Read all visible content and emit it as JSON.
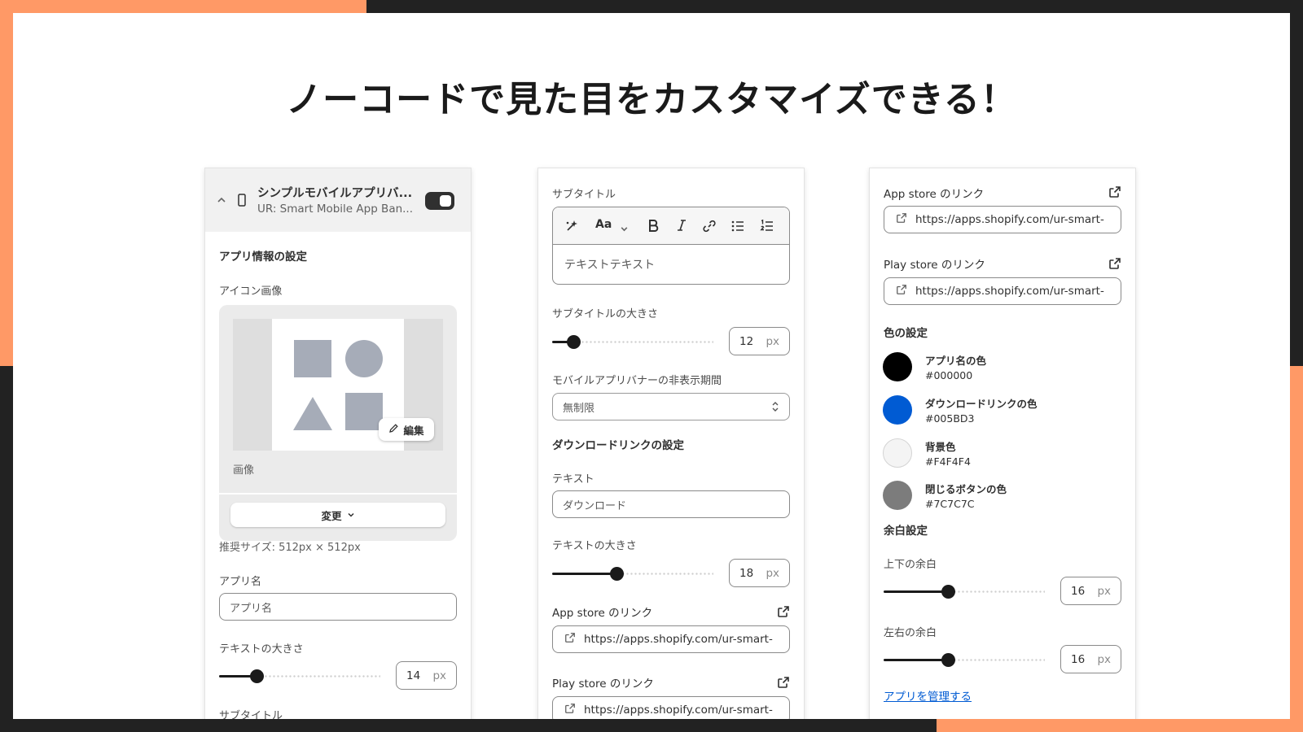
{
  "headline": "ノーコードで見た目をカスタマイズできる！",
  "colors": {
    "accent_orange": "#FF9966",
    "frame_dark": "#222222",
    "link_blue": "#005BD3"
  },
  "panel1": {
    "app_title": "シンプルモバイルアプリバ...",
    "app_subtitle": "UR: Smart Mobile App Ban...",
    "section_app_info": "アプリ情報の設定",
    "icon_image_label": "アイコン画像",
    "edit_label": "編集",
    "image_caption": "画像",
    "change_button": "変更",
    "recommended_size": "推奨サイズ: 512px × 512px",
    "app_name_label": "アプリ名",
    "app_name_value": "アプリ名",
    "text_size_label": "テキストの大きさ",
    "text_size_value": "14",
    "text_size_fraction": 0.23,
    "unit": "px",
    "subtitle_label": "サブタイトル"
  },
  "panel2": {
    "subtitle_label": "サブタイトル",
    "toolbar_font": "Aa",
    "editor_text": "テキストテキスト",
    "subtitle_size_label": "サブタイトルの大きさ",
    "subtitle_size_value": "12",
    "subtitle_size_fraction": 0.13,
    "unit": "px",
    "hide_period_label": "モバイルアプリバナーの非表示期間",
    "hide_period_value": "無制限",
    "download_section": "ダウンロードリンクの設定",
    "text_label": "テキスト",
    "text_value": "ダウンロード",
    "text_size_label": "テキストの大きさ",
    "text_size_value": "18",
    "text_size_fraction": 0.4,
    "app_store_label": "App store のリンク",
    "app_store_url": "https://apps.shopify.com/ur-smart-",
    "play_store_label": "Play store のリンク",
    "play_store_url": "https://apps.shopify.com/ur-smart-"
  },
  "panel3": {
    "app_store_label": "App store のリンク",
    "app_store_url": "https://apps.shopify.com/ur-smart-",
    "play_store_label": "Play store のリンク",
    "play_store_url": "https://apps.shopify.com/ur-smart-",
    "color_section": "色の設定",
    "color_items": [
      {
        "name": "アプリ名の色",
        "hex": "#000000"
      },
      {
        "name": "ダウンロードリンクの色",
        "hex": "#005BD3"
      },
      {
        "name": "背景色",
        "hex": "#F4F4F4"
      },
      {
        "name": "閉じるボタンの色",
        "hex": "#7C7C7C"
      }
    ],
    "margin_section": "余白設定",
    "vertical_label": "上下の余白",
    "vertical_value": "16",
    "vertical_fraction": 0.4,
    "horizontal_label": "左右の余白",
    "horizontal_value": "16",
    "horizontal_fraction": 0.4,
    "unit": "px",
    "manage_link": "アプリを管理する"
  }
}
